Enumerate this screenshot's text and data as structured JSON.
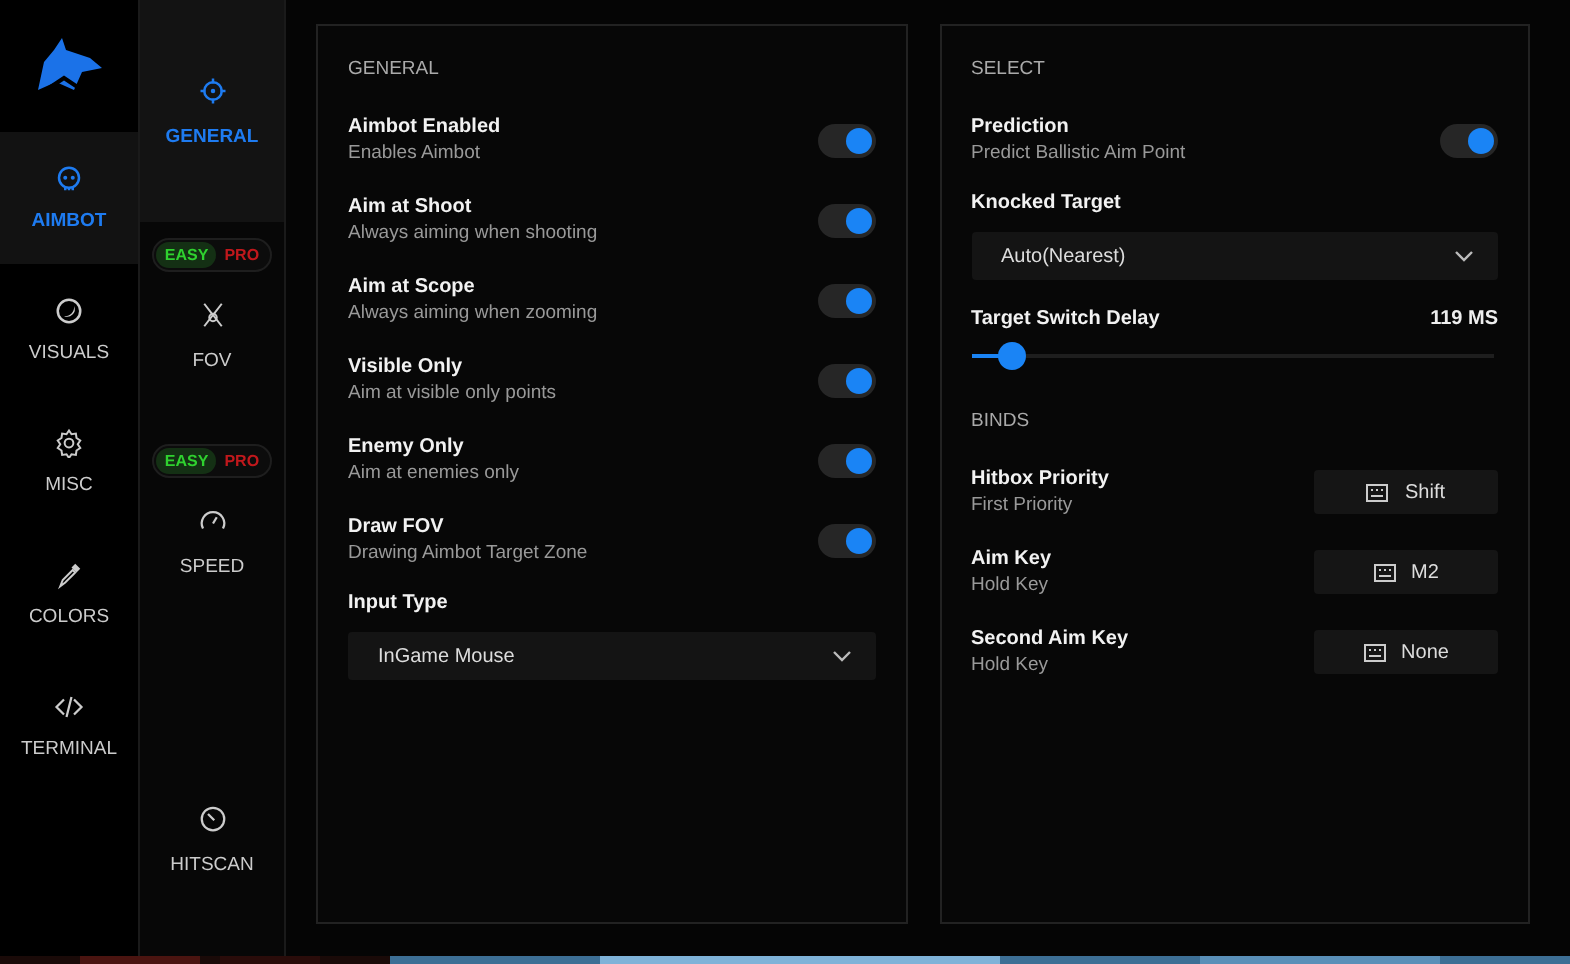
{
  "main_nav": [
    {
      "label": "AIMBOT",
      "selected": true
    },
    {
      "label": "VISUALS",
      "selected": false
    },
    {
      "label": "MISC",
      "selected": false
    },
    {
      "label": "COLORS",
      "selected": false
    },
    {
      "label": "TERMINAL",
      "selected": false
    }
  ],
  "sub_nav": [
    {
      "kind": "item",
      "label": "GENERAL",
      "selected": true
    },
    {
      "kind": "modes",
      "options": [
        {
          "label": "EASY",
          "selected": true
        },
        {
          "label": "PRO",
          "selected": false
        }
      ]
    },
    {
      "kind": "item",
      "label": "FOV",
      "selected": false
    },
    {
      "kind": "modes",
      "options": [
        {
          "label": "EASY",
          "selected": true
        },
        {
          "label": "PRO",
          "selected": false
        }
      ]
    },
    {
      "kind": "item",
      "label": "SPEED",
      "selected": false
    },
    {
      "kind": "item",
      "label": "HITSCAN",
      "selected": false
    }
  ],
  "panels": [
    {
      "sections": [
        {
          "title": "GENERAL",
          "rows": [
            {
              "kind": "toggle",
              "label": "Aimbot Enabled",
              "hint": "Enables Aimbot",
              "on": true
            },
            {
              "kind": "toggle",
              "label": "Aim at Shoot",
              "hint": "Always aiming when shooting",
              "on": true
            },
            {
              "kind": "toggle",
              "label": "Aim at Scope",
              "hint": "Always aiming when zooming",
              "on": true
            },
            {
              "kind": "toggle",
              "label": "Visible Only",
              "hint": "Aim at visible only points",
              "on": true
            },
            {
              "kind": "toggle",
              "label": "Enemy Only",
              "hint": "Aim at enemies only",
              "on": true
            },
            {
              "kind": "toggle",
              "label": "Draw FOV",
              "hint": "Drawing Aimbot Target Zone",
              "on": true
            },
            {
              "kind": "dropdown",
              "label": "Input Type",
              "value": "InGame Mouse"
            }
          ]
        }
      ]
    },
    {
      "sections": [
        {
          "title": "SELECT",
          "rows": [
            {
              "kind": "toggle",
              "label": "Prediction",
              "hint": "Predict Ballistic Aim Point",
              "on": true
            },
            {
              "kind": "dropdown",
              "label": "Knocked Target",
              "value": "Auto(Nearest)"
            },
            {
              "kind": "slider",
              "label": "Target Switch Delay",
              "reading": "119 MS",
              "level": 0.08
            }
          ]
        },
        {
          "title": "BINDS",
          "rows": [
            {
              "kind": "bind",
              "label": "Hitbox Priority",
              "hint": "First Priority",
              "key": "Shift"
            },
            {
              "kind": "bind",
              "label": "Aim Key",
              "hint": "Hold Key",
              "key": "M2"
            },
            {
              "kind": "bind",
              "label": "Second Aim Key",
              "hint": "Hold Key",
              "key": "None"
            }
          ]
        }
      ]
    }
  ]
}
